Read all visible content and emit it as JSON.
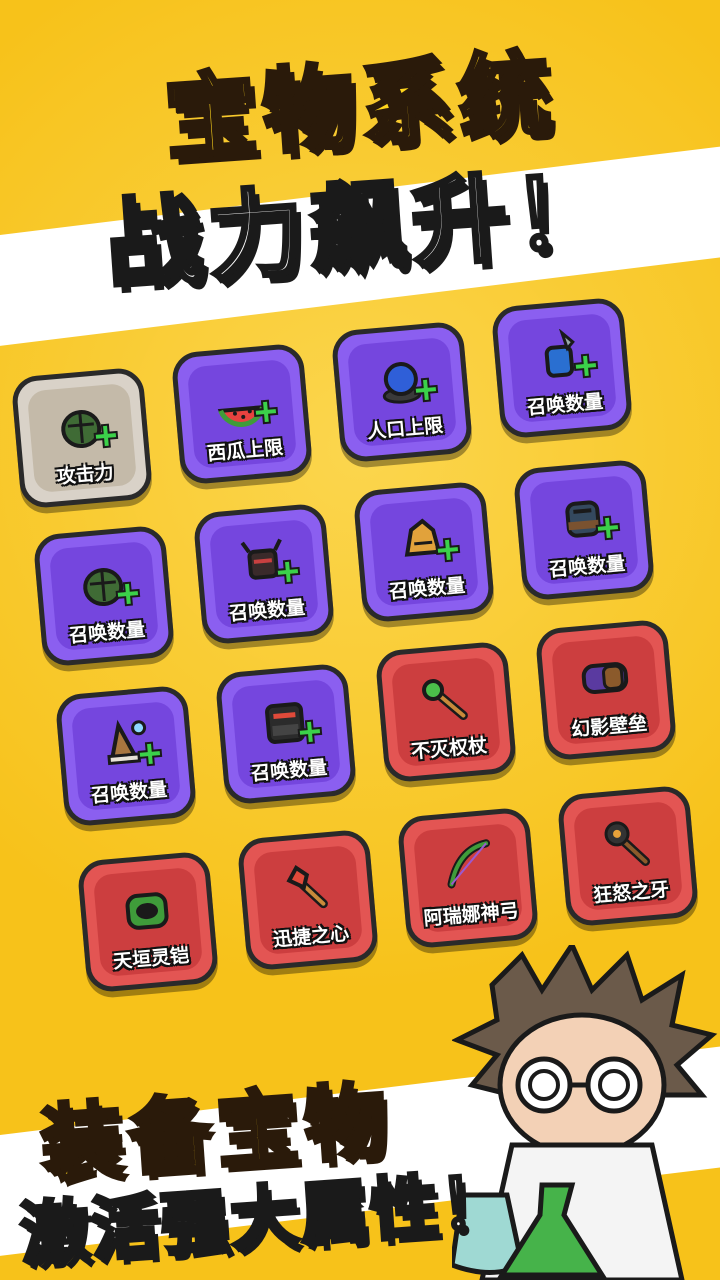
{
  "headline": {
    "line1": "宝物系统",
    "line2": "战力飙升！"
  },
  "footer": {
    "line1": "装备宝物",
    "line2": "激活强大属性！"
  },
  "treasures": [
    {
      "label": "攻击力",
      "rarity": "gray",
      "icon": "helmet-icon"
    },
    {
      "label": "西瓜上限",
      "rarity": "purple",
      "icon": "watermelon-icon"
    },
    {
      "label": "人口上限",
      "rarity": "purple",
      "icon": "blue-orb-icon"
    },
    {
      "label": "召唤数量",
      "rarity": "purple",
      "icon": "knight-icon"
    },
    {
      "label": "召唤数量",
      "rarity": "purple",
      "icon": "helmet-icon"
    },
    {
      "label": "召唤数量",
      "rarity": "purple",
      "icon": "demon-icon"
    },
    {
      "label": "召唤数量",
      "rarity": "purple",
      "icon": "golden-helm-icon"
    },
    {
      "label": "召唤数量",
      "rarity": "purple",
      "icon": "armored-warrior-icon"
    },
    {
      "label": "召唤数量",
      "rarity": "purple",
      "icon": "wizard-icon"
    },
    {
      "label": "召唤数量",
      "rarity": "purple",
      "icon": "black-golem-icon"
    },
    {
      "label": "不灭权杖",
      "rarity": "red",
      "icon": "scepter-icon"
    },
    {
      "label": "幻影壁垒",
      "rarity": "red",
      "icon": "shield-icon"
    },
    {
      "label": "天垣灵铠",
      "rarity": "red",
      "icon": "green-armor-icon"
    },
    {
      "label": "迅捷之心",
      "rarity": "red",
      "icon": "torch-icon"
    },
    {
      "label": "阿瑞娜神弓",
      "rarity": "red",
      "icon": "bow-icon"
    },
    {
      "label": "狂怒之牙",
      "rarity": "red",
      "icon": "spiked-mace-icon"
    }
  ],
  "colors": {
    "background": "#f7c21a",
    "gray": "#d9d2c8",
    "purple": "#8b5ff0",
    "red": "#e35553",
    "plus": "#3bd14a"
  }
}
